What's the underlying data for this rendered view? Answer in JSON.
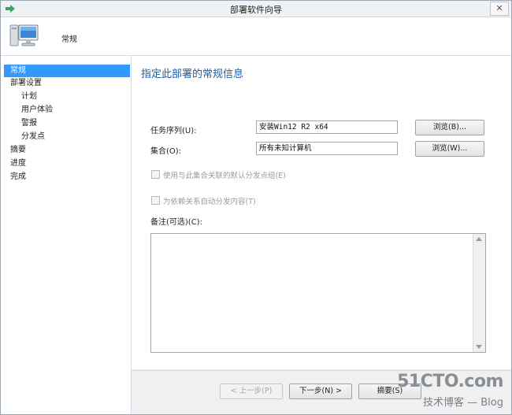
{
  "window": {
    "title": "部署软件向导",
    "close_glyph": "✕"
  },
  "header": {
    "text": "常规"
  },
  "nav": {
    "items": [
      {
        "label": "常规",
        "selected": true,
        "level": 0
      },
      {
        "label": "部署设置",
        "selected": false,
        "level": 0
      },
      {
        "label": "计划",
        "selected": false,
        "level": 1
      },
      {
        "label": "用户体验",
        "selected": false,
        "level": 1
      },
      {
        "label": "警报",
        "selected": false,
        "level": 1
      },
      {
        "label": "分发点",
        "selected": false,
        "level": 1
      },
      {
        "label": "摘要",
        "selected": false,
        "level": 0
      },
      {
        "label": "进度",
        "selected": false,
        "level": 0
      },
      {
        "label": "完成",
        "selected": false,
        "level": 0
      }
    ]
  },
  "content": {
    "section_title": "指定此部署的常规信息",
    "task_sequence": {
      "label": "任务序列(U):",
      "value": "安装Win12 R2 x64",
      "browse": "浏览(B)..."
    },
    "collection": {
      "label": "集合(O):",
      "value": "所有未知计算机",
      "browse": "浏览(W)..."
    },
    "checkbox1": {
      "label": "使用与此集合关联的默认分发点组(E)",
      "checked": false,
      "enabled": false
    },
    "checkbox2": {
      "label": "为依赖关系自动分发内容(T)",
      "checked": false,
      "enabled": false
    },
    "notes": {
      "label": "备注(可选)(C):",
      "value": ""
    }
  },
  "footer": {
    "prev": "< 上一步(P)",
    "next": "下一步(N) >",
    "summary": "摘要(S)"
  },
  "watermark": {
    "big": "51CTO.com",
    "small": "技术博客 — Blog"
  },
  "colors": {
    "accent": "#3399ff",
    "title_blue": "#1a5da8"
  }
}
